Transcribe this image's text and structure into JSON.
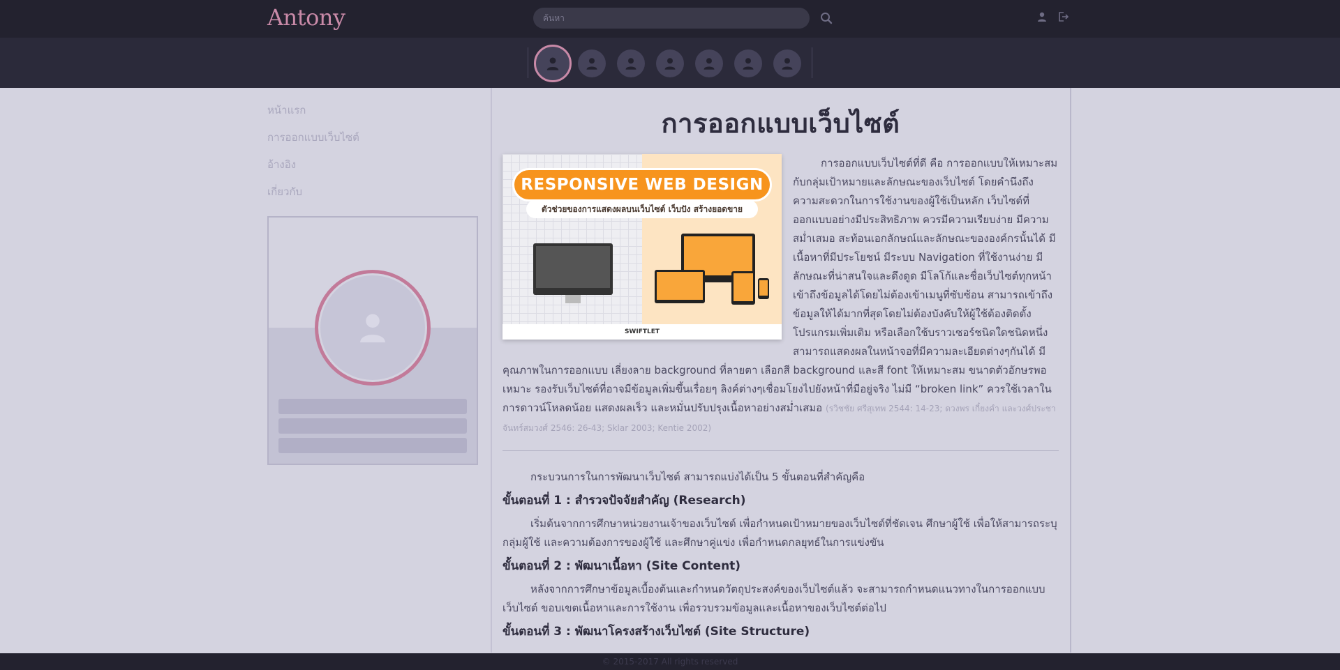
{
  "header": {
    "brand": "Antony",
    "search_placeholder": "ค้นหา",
    "icons": {
      "search": "search-icon",
      "user": "user-icon",
      "logout": "logout-icon"
    }
  },
  "avatar_strip": {
    "count": 7,
    "active_index": 0
  },
  "sidebar": {
    "nav": [
      {
        "label": "หน้าแรก"
      },
      {
        "label": "การออกแบบเว็บไซต์"
      },
      {
        "label": "อ้างอิง"
      },
      {
        "label": "เกี่ยวกับ"
      }
    ]
  },
  "main": {
    "title": "การออกแบบเว็บไซต์",
    "hero": {
      "banner": "RESPONSIVE WEB DESIGN",
      "subtitle": "ตัวช่วยของการแสดงผลบนเว็บไซต์ เว็บปัง สร้างยอดขาย",
      "footer_logo": "SWIFTLET"
    },
    "intro": "การออกแบบเว็บไซต์ที่ดี คือ การออกแบบให้เหมาะสมกับกลุ่มเป้าหมายและลักษณะของเว็บไซต์ โดยคำนึงถึงความสะดวกในการใช้งานของผู้ใช้เป็นหลัก เว็บไซต์ที่ออกแบบอย่างมีประสิทธิภาพ ควรมีความเรียบง่าย มีความสม่ำเสมอ สะท้อนเอกลักษณ์และลักษณะขององค์กรนั้นได้ มีเนื้อหาที่มีประโยชน์ มีระบบ Navigation ที่ใช้งานง่าย มีลักษณะที่น่าสนใจและดึงดูด มีโลโก้และชื่อเว็บไซต์ทุกหน้า เข้าถึงข้อมูลได้โดยไม่ต้องเข้าเมนูที่ซับซ้อน สามารถเข้าถึงข้อมูลให้ได้มากที่สุดโดยไม่ต้องบังคับให้ผู้ใช้ต้องติดตั้งโปรแกรมเพิ่มเติม หรือเลือกใช้บราวเซอร์ชนิดใดชนิดหนึ่ง สามารถแสดงผลในหน้าจอที่มีความละเอียดต่างๆกันได้ มีคุณภาพในการออกแบบ เลี่ยงลาย background ที่ลายตา เลือกสี background และสี font ให้เหมาะสม ขนาดตัวอักษรพอเหมาะ รองรับเว็บไซต์ที่อาจมีข้อมูลเพิ่มขึ้นเรื่อยๆ ลิงค์ต่างๆเชื่อมโยงไปยังหน้าที่มีอยู่จริง ไม่มี “broken link” ควรใช้เวลาในการดาวน์โหลดน้อย แสดงผลเร็ว และหมั่นปรับปรุงเนื้อหาอย่างสม่ำเสมอ",
    "citation": "(รวิชชัย ศรีสุเทพ 2544: 14-23; ดวงพร เกี๋ยงคำ และวงศ์ประชา จันทร์สมวงศ์ 2546: 26-43; Sklar 2003; Kentie 2002)",
    "process_intro": "กระบวนการในการพัฒนาเว็บไซต์ สามารถแบ่งได้เป็น 5 ขั้นตอนที่สำคัญคือ",
    "steps": [
      {
        "title": "ขั้นตอนที่ 1 : สำรวจปัจจัยสำคัญ (Research)",
        "body": "เริ่มต้นจากการศึกษาหน่วยงานเจ้าของเว็บไซต์ เพื่อกำหนดเป้าหมายของเว็บไซต์ที่ชัดเจน ศึกษาผู้ใช้ เพื่อให้สามารถระบุกลุ่มผู้ใช้ และความต้องการของผู้ใช้ และศึกษาคู่แข่ง เพื่อกำหนดกลยุทธ์ในการแข่งขัน"
      },
      {
        "title": "ขั้นตอนที่ 2 : พัฒนาเนื้อหา (Site Content)",
        "body": "หลังจากการศึกษาข้อมูลเบื้องต้นและกำหนดวัตถุประสงค์ของเว็บไซต์แล้ว จะสามารถกำหนดแนวทางในการออกแบบเว็บไซต์ ขอบเขตเนื้อหาและการใช้งาน เพื่อรวบรวมข้อมูลและเนื้อหาของเว็บไซต์ต่อไป"
      },
      {
        "title": "ขั้นตอนที่ 3 : พัฒนาโครงสร้างเว็บไซต์ (Site Structure)",
        "body": ""
      }
    ]
  },
  "footer": {
    "text": "© 2015-2017 All rights reserved"
  },
  "colors": {
    "topbar": "#23222f",
    "strip": "#2b2a3a",
    "page_bg": "#d4d3e0",
    "accent": "#c98aa8"
  }
}
